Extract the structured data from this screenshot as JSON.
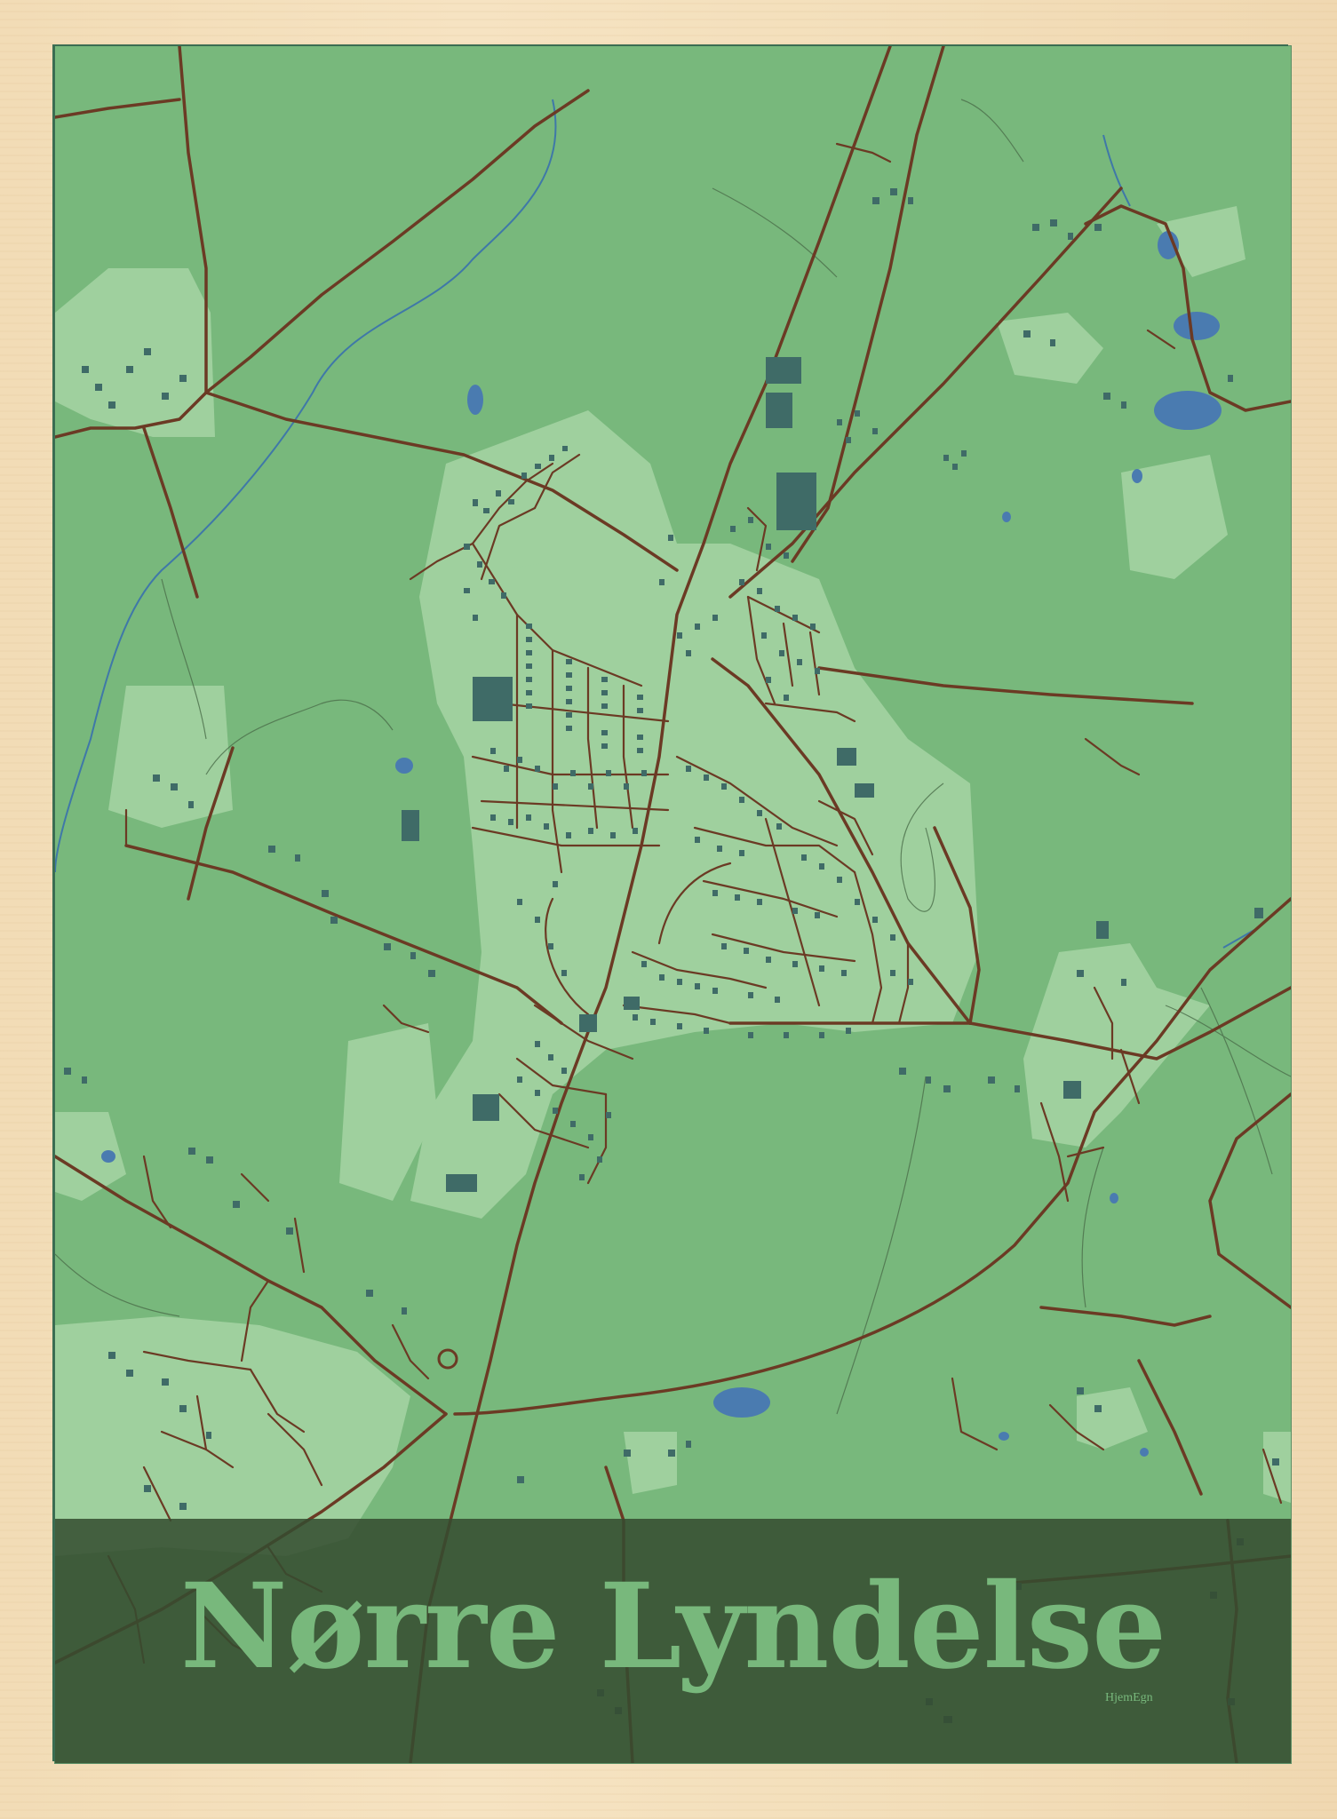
{
  "poster": {
    "title": "Nørre Lyndelse",
    "brand": "HjemEgn"
  },
  "colors": {
    "frame": "#f3dfbb",
    "land": "#78b87c",
    "urban": "#9fd09e",
    "road": "#6b3a24",
    "building": "#3f6b67",
    "water": "#4a7bb0",
    "stream": "#3f78a8",
    "title_band": "#344c30",
    "title_text": "#78b87c"
  },
  "icons": {
    "roundabout": "roundabout-icon"
  }
}
